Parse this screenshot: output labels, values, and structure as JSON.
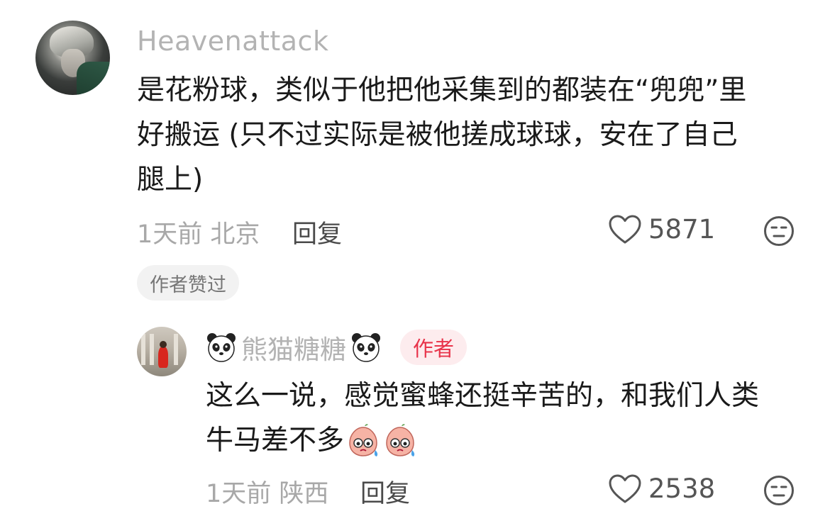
{
  "comment": {
    "username": "Heavenattack",
    "text_lines": [
      "是花粉球，类似于他把他采集到的都装在“兜兜”里",
      "好搬运 (只不过实际是被他搓成球球，安在了自己",
      "腿上)"
    ],
    "time_location": "1天前 北京",
    "reply_label": "回复",
    "like_count": "5871",
    "liked_badge": "作者赞过",
    "icons": {
      "like": "heart-outline-icon",
      "reaction": "neutral-face-icon"
    }
  },
  "reply": {
    "username": "熊猫糖糖",
    "author_tag": "作者",
    "text_lines": [
      "这么一说，感觉蜜蜂还挺辛苦的，和我们人类",
      "牛马差不多"
    ],
    "time_location": "1天前 陕西",
    "reply_label": "回复",
    "like_count": "2538",
    "icons": {
      "name_decoration": "panda-face-icon",
      "inline_emoji": "sweating-face-emoji",
      "like": "heart-outline-icon",
      "reaction": "neutral-face-icon"
    }
  },
  "colors": {
    "username": "#b3b3b3",
    "author_tag_text": "#e8334a",
    "author_tag_bg": "#fdecee"
  }
}
